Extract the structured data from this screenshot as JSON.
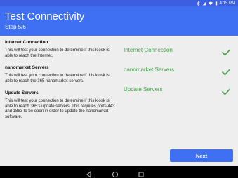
{
  "status_bar": {
    "time": "4:15 PM",
    "icons": [
      "bluetooth-icon",
      "signal-icon",
      "wifi-icon",
      "battery-icon"
    ]
  },
  "header": {
    "title": "Test Connectivity",
    "step": "Step 5/6"
  },
  "sections": [
    {
      "title": "Internet Connection",
      "description": "This will test your connection to determine if this kiosk is able to reach the Internet."
    },
    {
      "title": "nanomarket Servers",
      "description": "This will test your connection to determine if this kiosk is able to reach the 365 nanomarket servers."
    },
    {
      "title": "Update Servers",
      "description": "This will test your connection to determine if this kiosk is able to reach 365's update servers. This requires ports 443 and 1883 to be open in order to update the nanomarket software."
    }
  ],
  "checks": [
    {
      "label": "Internet Connection",
      "status": "passed",
      "icon": "checkmark-icon"
    },
    {
      "label": "nanomarket Servers",
      "status": "passed",
      "icon": "checkmark-icon"
    },
    {
      "label": "Update Servers",
      "status": "passed",
      "icon": "checkmark-icon"
    }
  ],
  "actions": {
    "next_label": "Next"
  },
  "nav": {
    "buttons": [
      "back-icon",
      "home-icon",
      "recents-icon"
    ]
  },
  "colors": {
    "header": "#3f6ff2",
    "status_bar": "#3b5fe0",
    "success": "#43a047",
    "button": "#3f6ff2",
    "background": "#eeeeee"
  }
}
